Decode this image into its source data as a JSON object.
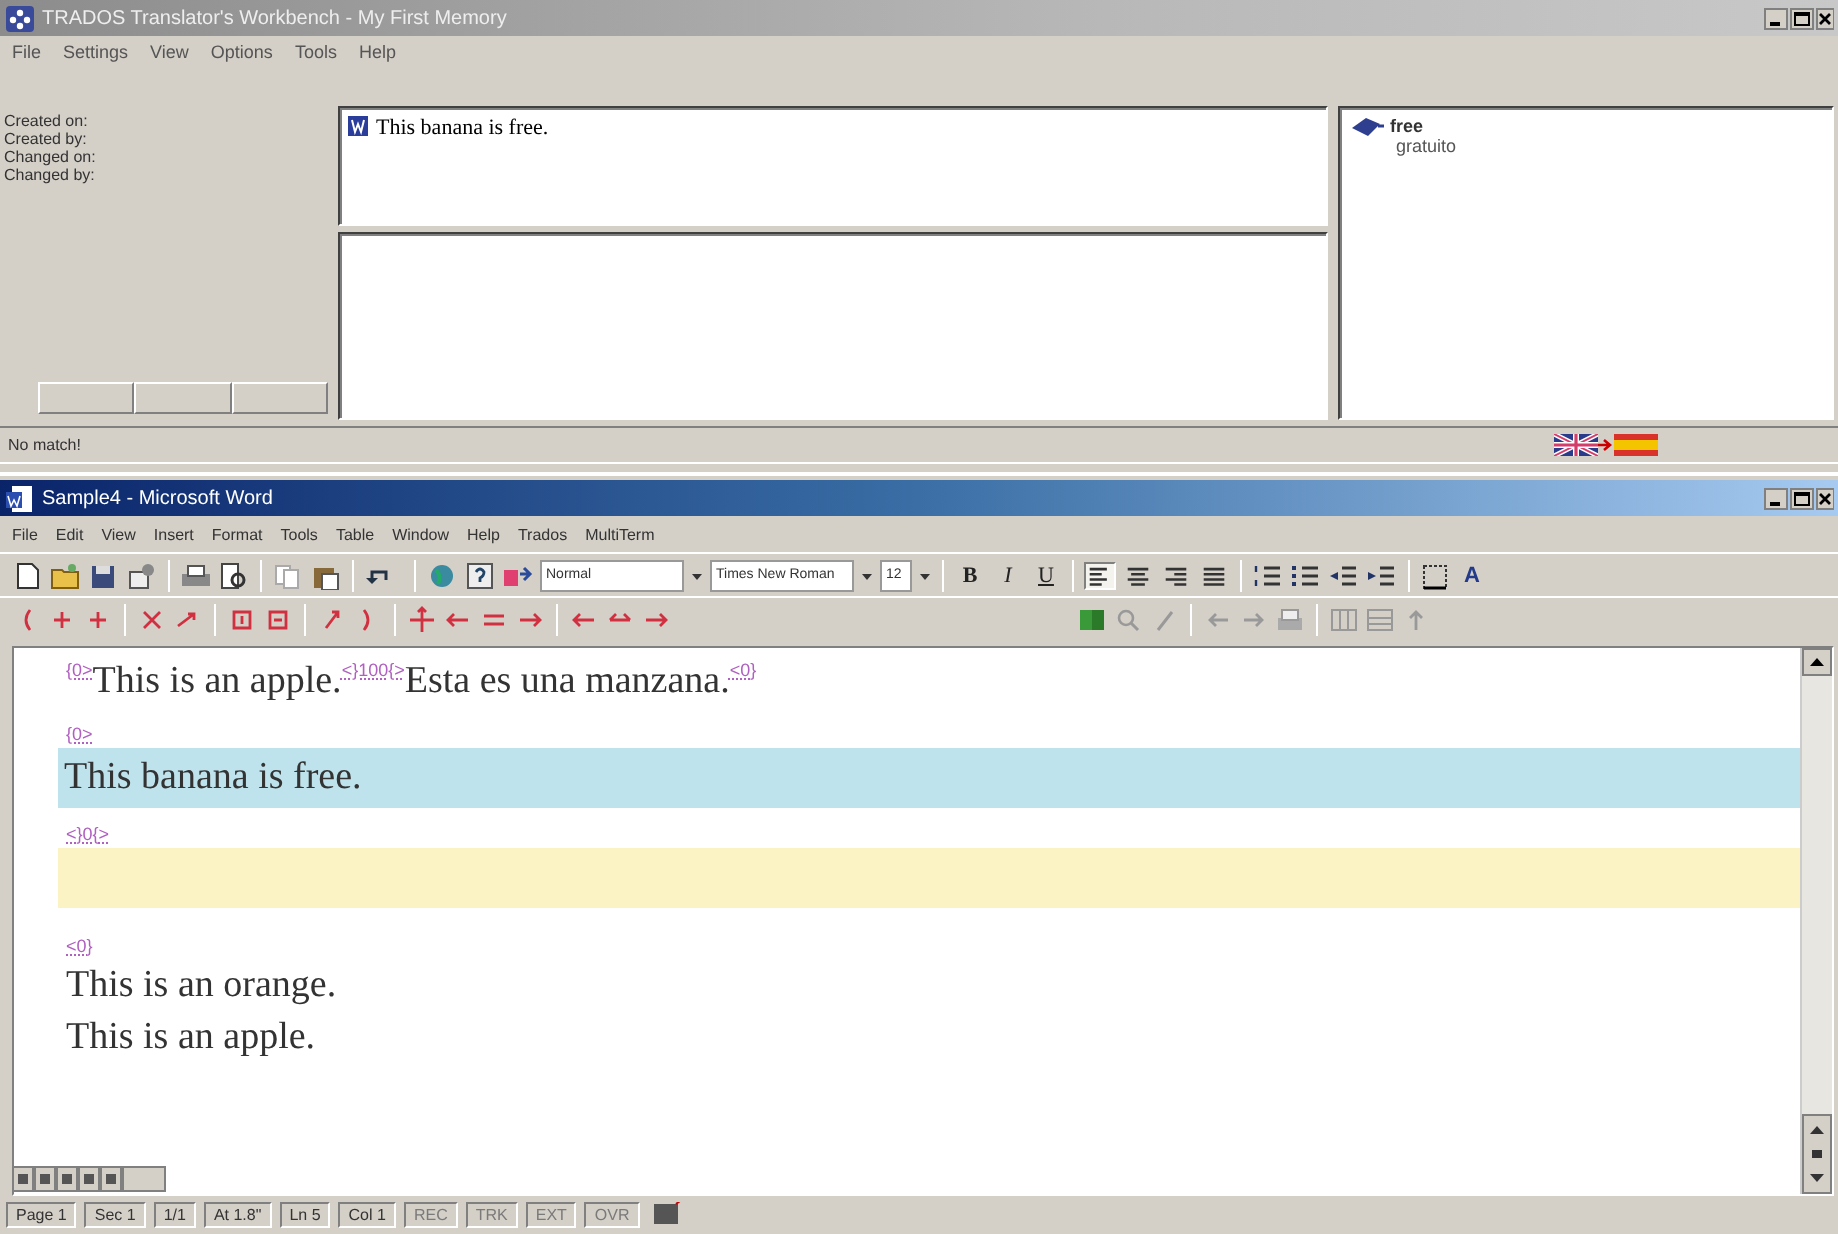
{
  "workbench": {
    "title": "TRADOS Translator's Workbench - My First Memory",
    "menu": [
      "File",
      "Settings",
      "View",
      "Options",
      "Tools",
      "Help"
    ],
    "info_labels": [
      "Created on:",
      "Created by:",
      "Changed on:",
      "Changed by:"
    ],
    "source_segment": "This banana is free.",
    "terminology": [
      {
        "term": "free",
        "translation": "gratuito"
      }
    ],
    "status": "No match!"
  },
  "word": {
    "title": "Sample4 - Microsoft Word",
    "menu": [
      "File",
      "Edit",
      "View",
      "Insert",
      "Format",
      "Tools",
      "Table",
      "Window",
      "Help",
      "Trados",
      "MultiTerm"
    ],
    "formatting": {
      "style": "Normal",
      "font": "Times New Roman",
      "size": "12",
      "bold": "B",
      "italic": "I",
      "underline": "U",
      "font_color": "A"
    },
    "alignment_buttons": [
      {
        "selected": true
      },
      {
        "selected": false
      },
      {
        "selected": false
      },
      {
        "selected": false
      }
    ],
    "document": [
      {
        "kind": "closed",
        "open_tag": "{0>",
        "source": "This is an apple.",
        "match_tag": "<}100{>",
        "target": "Esta es una manzana.",
        "close_tag": "<0}"
      },
      {
        "kind": "tag",
        "text": "{0>"
      },
      {
        "kind": "source",
        "text": "This banana is free."
      },
      {
        "kind": "tag",
        "text": "<}0{>"
      },
      {
        "kind": "target"
      },
      {
        "kind": "tag",
        "text": "<0}"
      },
      {
        "kind": "text",
        "text": "This is an orange."
      },
      {
        "kind": "text",
        "text": "This is an apple."
      }
    ],
    "status_bar": [
      {
        "text": "Page 1",
        "disabled": false
      },
      {
        "text": "Sec 1",
        "disabled": false
      },
      {
        "text": "1/1",
        "disabled": false
      },
      {
        "text": "At 1.8\"",
        "disabled": false
      },
      {
        "text": "Ln 5",
        "disabled": false
      },
      {
        "text": "Col 1",
        "disabled": false
      },
      {
        "text": "REC",
        "disabled": true
      },
      {
        "text": "TRK",
        "disabled": true
      },
      {
        "text": "EXT",
        "disabled": true
      },
      {
        "text": "OVR",
        "disabled": true
      }
    ]
  }
}
